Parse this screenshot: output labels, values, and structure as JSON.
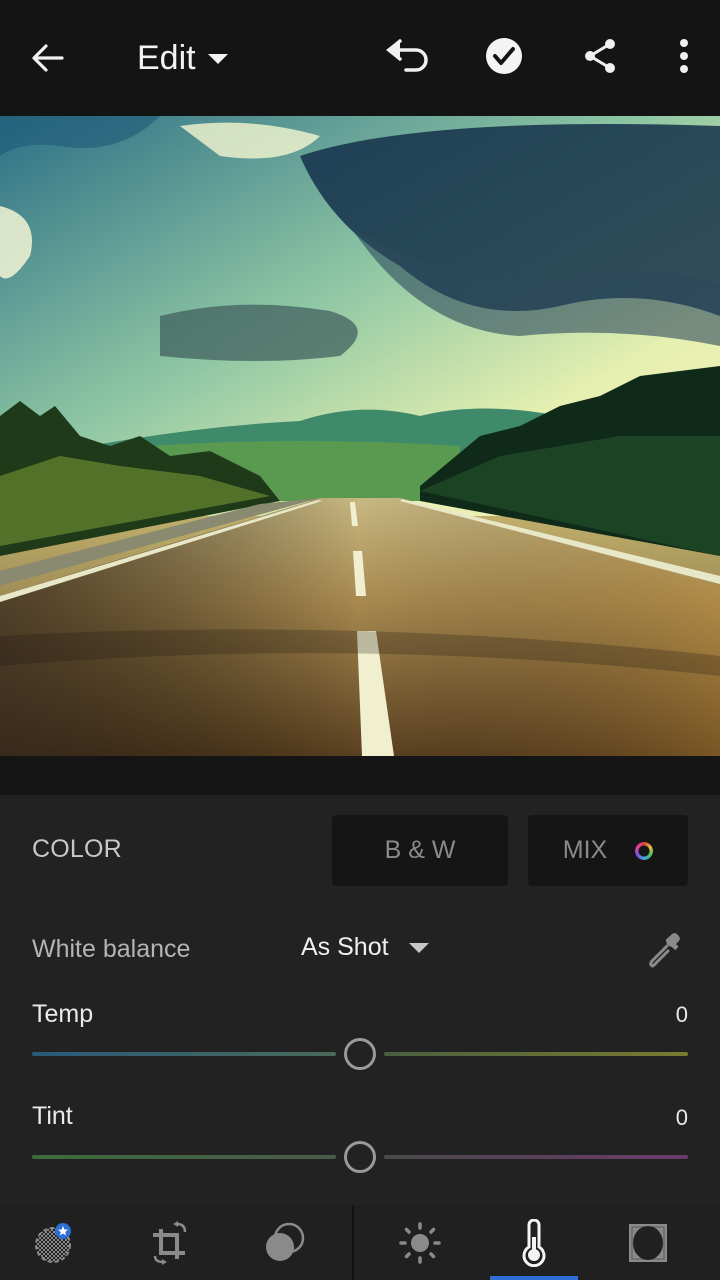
{
  "topbar": {
    "back_icon": "arrow-left-icon",
    "title": "Edit",
    "title_dropdown_icon": "caret-down-icon",
    "actions": [
      {
        "name": "undo",
        "icon": "undo-icon"
      },
      {
        "name": "done",
        "icon": "check-circle-icon"
      },
      {
        "name": "share",
        "icon": "share-icon"
      },
      {
        "name": "more",
        "icon": "more-vertical-icon"
      }
    ]
  },
  "photo": {
    "description": "Road stretching to mountains under dramatic sky"
  },
  "panel": {
    "section_label": "COLOR",
    "bw_button": "B & W",
    "mix_button": "MIX",
    "white_balance": {
      "label": "White balance",
      "value": "As Shot"
    },
    "sliders": [
      {
        "name": "temp",
        "label": "Temp",
        "value": "0",
        "position": 0.5,
        "gradient_left": [
          "#2a5a7a",
          "#4a6a5a"
        ],
        "gradient_right": [
          "#4a6040",
          "#7a7a30"
        ]
      },
      {
        "name": "tint",
        "label": "Tint",
        "value": "0",
        "position": 0.5,
        "gradient_left": [
          "#3d6b3d",
          "#4a5a4a"
        ],
        "gradient_right": [
          "#4a4a4a",
          "#6a3a6a"
        ]
      }
    ]
  },
  "bottom_tools": [
    {
      "name": "selective",
      "icon": "selective-brush-icon",
      "badge": "star-badge-icon",
      "active": false
    },
    {
      "name": "crop",
      "icon": "crop-rotate-icon",
      "active": false
    },
    {
      "name": "presets",
      "icon": "presets-icon",
      "active": false
    },
    {
      "name": "light",
      "icon": "sun-icon",
      "active": false
    },
    {
      "name": "color",
      "icon": "thermometer-icon",
      "active": true
    },
    {
      "name": "effects",
      "icon": "vignette-icon",
      "active": false
    }
  ],
  "colors": {
    "accent": "#2e6fd6",
    "panel_bg": "#222222",
    "topbar_bg": "#141414"
  }
}
